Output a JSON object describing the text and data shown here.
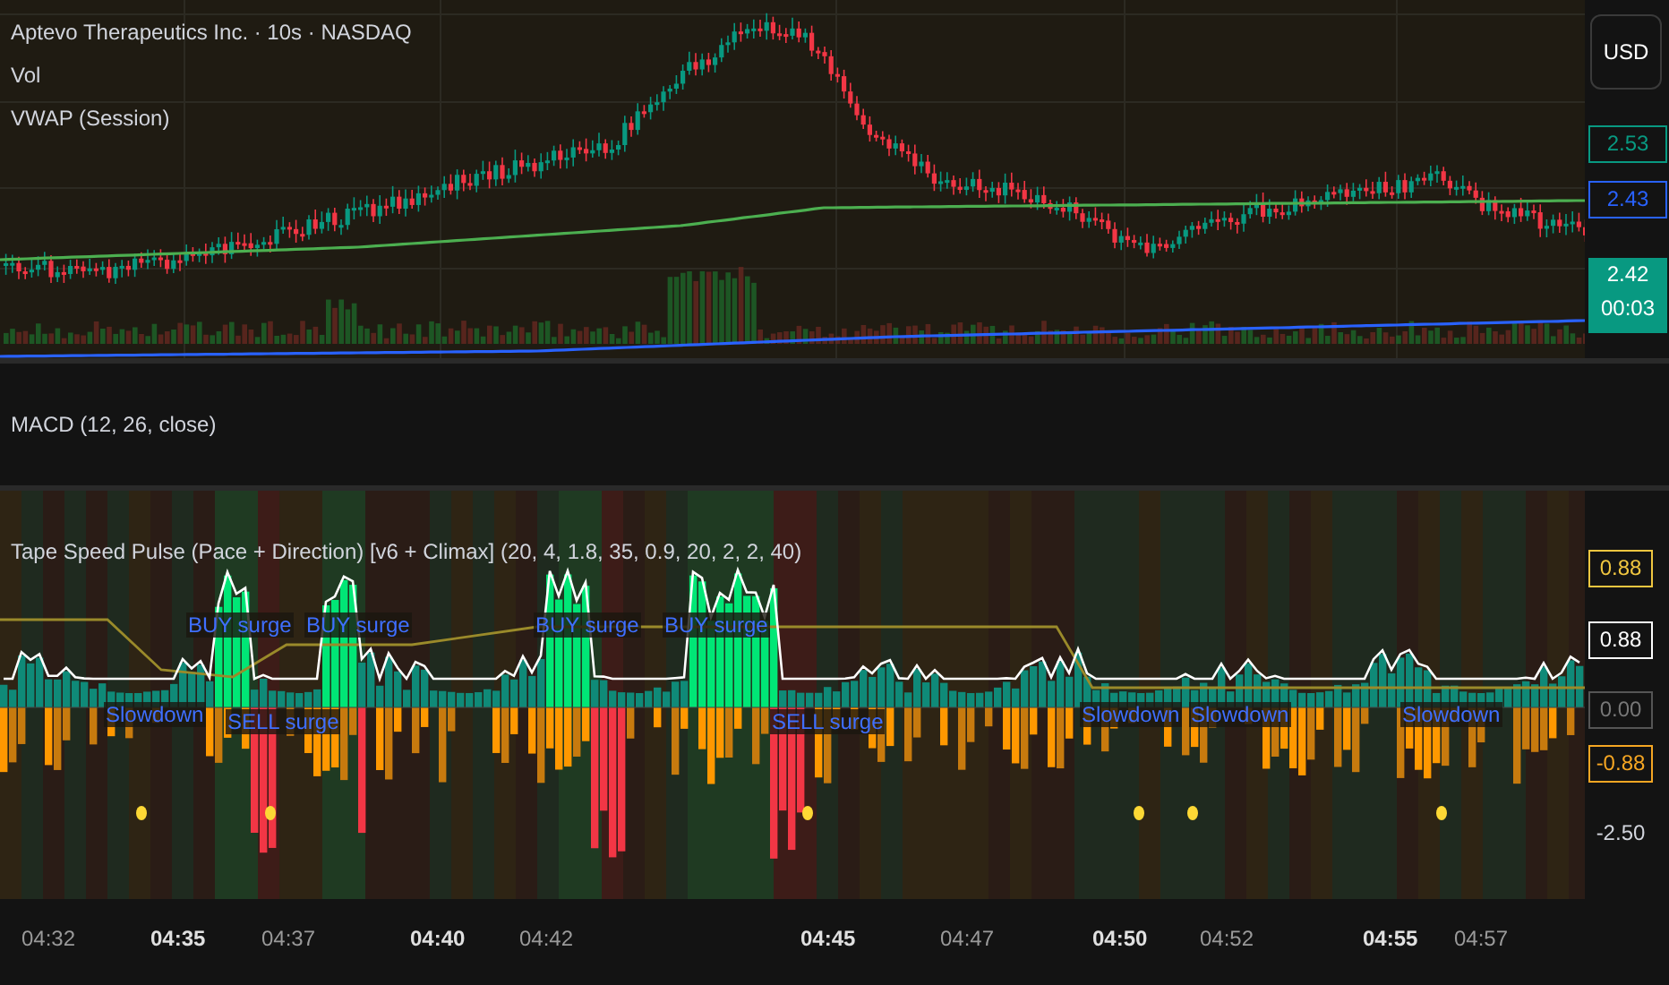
{
  "chart_header": {
    "title": "Aptevo Therapeutics Inc. · 10s · NASDAQ"
  },
  "legend": [
    {
      "label": "Vol"
    },
    {
      "label": "VWAP (Session)"
    }
  ],
  "price_axis": {
    "currency": "USD",
    "tags": [
      {
        "kind": "outline",
        "value": "2.53",
        "color": "#089981"
      },
      {
        "kind": "outline",
        "value": "2.43",
        "color": "#2962ff"
      },
      {
        "kind": "filled",
        "value": "2.42",
        "color": "#089981",
        "countdown": "00:03"
      }
    ]
  },
  "macd": {
    "title": "MACD (12, 26, close)"
  },
  "indicator": {
    "title": "Tape Speed Pulse (Pace + Direction) [v6 + Climax] (20, 4, 1.8, 35, 0.9, 20, 2, 2, 40)",
    "signals": [
      {
        "kind": "buy",
        "text": "BUY surge"
      },
      {
        "kind": "buy",
        "text": "BUY surge"
      },
      {
        "kind": "buy",
        "text": "BUY surge"
      },
      {
        "kind": "buy",
        "text": "BUY surge"
      },
      {
        "kind": "slowdown",
        "text": "Slowdown"
      },
      {
        "kind": "sell",
        "text": "SELL surge"
      },
      {
        "kind": "sell",
        "text": "SELL surge"
      },
      {
        "kind": "slowdown",
        "text": "Slowdown"
      },
      {
        "kind": "slowdown",
        "text": "Slowdown"
      },
      {
        "kind": "slowdown",
        "text": "Slowdown"
      }
    ],
    "axis_tags": [
      {
        "kind": "outline",
        "value": "0.88",
        "color": "#f0c640"
      },
      {
        "kind": "filled",
        "value": "0.88",
        "color": "#ffffff"
      },
      {
        "kind": "filled",
        "value": "0.00",
        "color": "#555555"
      },
      {
        "kind": "outline",
        "value": "-0.88",
        "color": "#f5a623"
      },
      {
        "kind": "plain",
        "value": "-2.50",
        "color": "#d1d4dc"
      }
    ]
  },
  "time_axis": [
    {
      "label": "04:32",
      "major": false
    },
    {
      "label": "04:35",
      "major": true
    },
    {
      "label": "04:37",
      "major": false
    },
    {
      "label": "04:40",
      "major": true
    },
    {
      "label": "04:42",
      "major": false
    },
    {
      "label": "04:45",
      "major": true
    },
    {
      "label": "04:47",
      "major": false
    },
    {
      "label": "04:50",
      "major": true
    },
    {
      "label": "04:52",
      "major": false
    },
    {
      "label": "04:55",
      "major": true
    },
    {
      "label": "04:57",
      "major": false
    }
  ]
}
